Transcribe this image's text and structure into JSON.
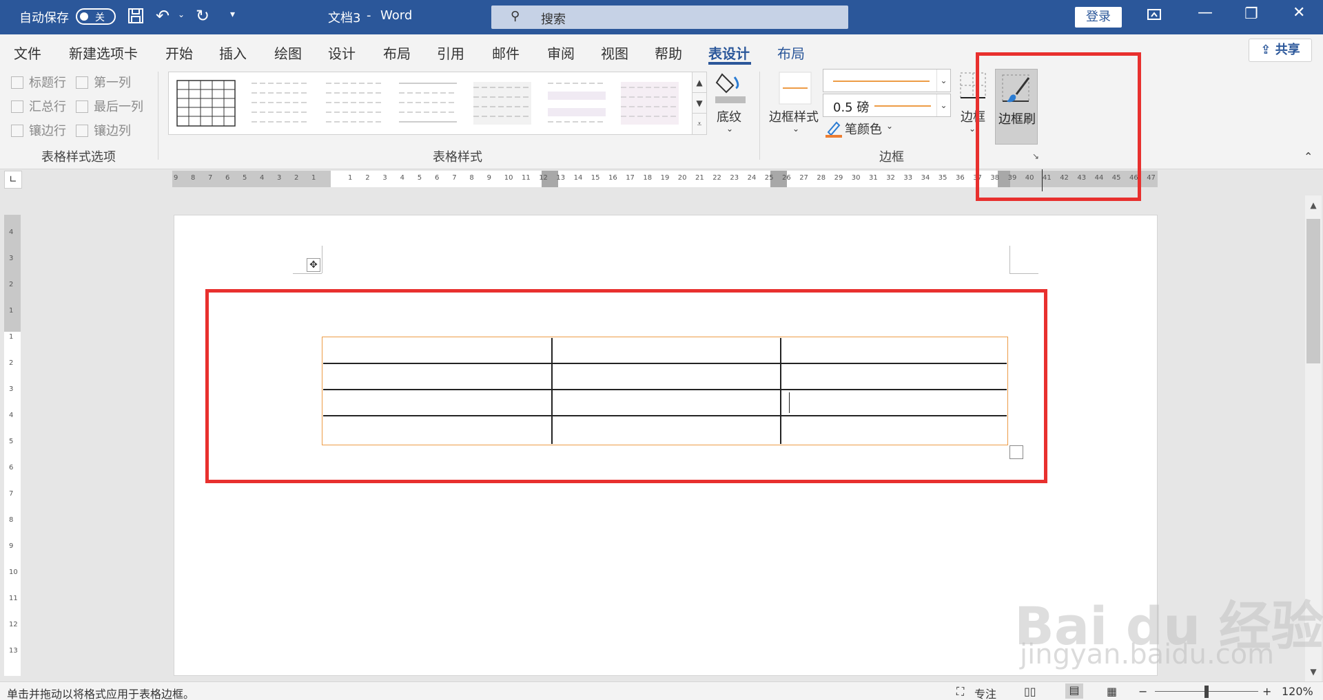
{
  "titlebar": {
    "autosave_label": "自动保存",
    "autosave_state": "关",
    "doc_title": "文档3",
    "separator": "-",
    "app_name": "Word",
    "search_placeholder": "搜索",
    "login_label": "登录"
  },
  "tabs": [
    "文件",
    "新建选项卡",
    "开始",
    "插入",
    "绘图",
    "设计",
    "布局",
    "引用",
    "邮件",
    "审阅",
    "视图",
    "帮助",
    "表设计",
    "布局"
  ],
  "active_tab_index": 12,
  "share_label": "共享",
  "ribbon": {
    "table_style_options": {
      "checkboxes": [
        "标题行",
        "第一列",
        "汇总行",
        "最后一列",
        "镶边行",
        "镶边列"
      ],
      "group_label": "表格样式选项"
    },
    "table_styles": {
      "group_label": "表格样式",
      "shading_label": "底纹"
    },
    "borders": {
      "border_styles_label": "边框样式",
      "pen_weight": "0.5 磅",
      "pen_color_label": "笔颜色",
      "borders_label": "边框",
      "border_painter_label": "边框刷",
      "group_label": "边框"
    }
  },
  "ruler": {
    "left_numbers": [
      "9",
      "8",
      "7",
      "6",
      "5",
      "4",
      "3",
      "2",
      "1"
    ],
    "right_numbers": [
      "1",
      "2",
      "3",
      "4",
      "5",
      "6",
      "7",
      "8",
      "9",
      "10",
      "11",
      "12",
      "13",
      "14",
      "15",
      "16",
      "17",
      "18",
      "19",
      "20",
      "21",
      "22",
      "23",
      "24",
      "25",
      "26",
      "27",
      "28",
      "29",
      "30",
      "31",
      "32",
      "33",
      "34",
      "35",
      "36",
      "37",
      "38",
      "39",
      "40",
      "41",
      "42",
      "43",
      "44",
      "45",
      "46",
      "47"
    ]
  },
  "vruler_numbers": [
    "4",
    "3",
    "2",
    "1",
    "1",
    "2",
    "3",
    "4",
    "5",
    "6",
    "7",
    "8",
    "9",
    "10",
    "11",
    "12",
    "13"
  ],
  "statusbar": {
    "hint": "单击并拖动以将格式应用于表格边框。",
    "focus_label": "专注",
    "zoom": "120%"
  },
  "watermark": {
    "logo": "Bai du 经验",
    "url": "jingyan.baidu.com"
  },
  "colors": {
    "title_blue": "#2b579a",
    "highlight_red": "#e8302e",
    "border_orange": "#ed9b45"
  }
}
